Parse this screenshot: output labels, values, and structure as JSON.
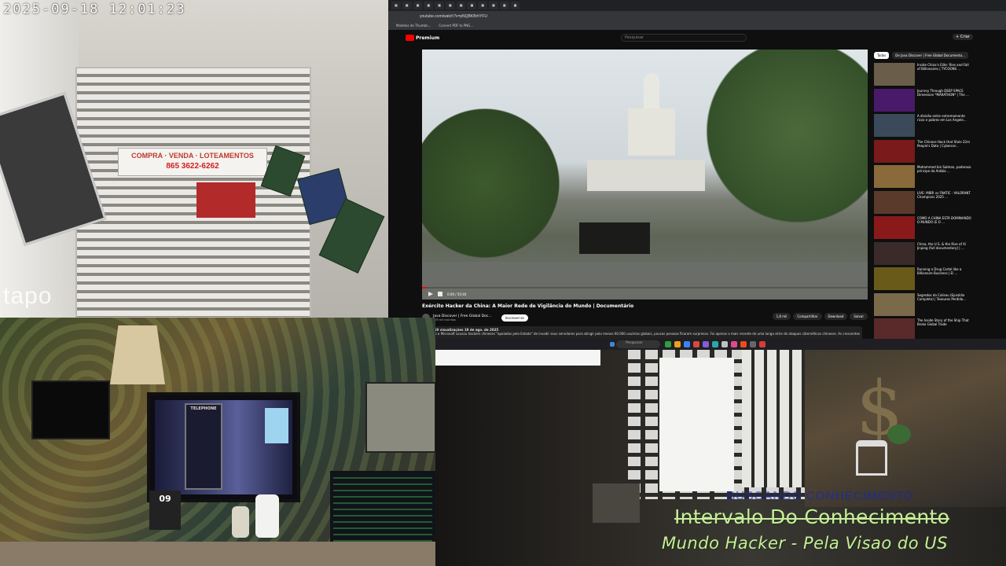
{
  "camera_top_left": {
    "timestamp": "2025-09-18  12:01:23",
    "brand": "tapo",
    "sign_line1": "COMPRA · VENDA · LOTEAMENTOS",
    "sign_phone": "865 3622-6262"
  },
  "youtube": {
    "url": "youtube.com/watch?v=pNQBKBrhYFU",
    "bookmarks": [
      "Modelos de Thumbn...",
      "Convert PDF to PNG..."
    ],
    "logo": "Premium",
    "search_placeholder": "Pesquisar",
    "create_label": "+ Criar",
    "time": "0:00 / 50:40",
    "video_title": "Exército Hacker da China: A Maior Rede de Vigilância do Mundo | Documentário",
    "channel_name": "Java Discover | Free Global Doc...",
    "channel_subs": "809 mil inscritos",
    "subscribe_label": "Inscrever-se",
    "actions": [
      "1,8 mil",
      "Compartilhar",
      "Download",
      "Salvar"
    ],
    "description_meta": "101.619 visualizações  19 de ago. de 2025",
    "description_text": "Quando a Microsoft acusou hackers chineses \"apoiados pelo Estado\" de invadir seus servidores para atingir pelo menos 60.000 usuários globais, poucas pessoas ficaram surpresas. Foi apenas o mais recente de uma longa série de ataques cibernéticos chineses. As crescentes preocupações",
    "chips": [
      "Todos",
      "De Java Discover | Free Global Documenta..."
    ],
    "recommendations": [
      {
        "title": "Inside China's Elite: Rise and Fall of Billionaires | TYCOONS ..."
      },
      {
        "title": "Journey Through DEEP SPACE Dimension *MARATHON* | The ..."
      },
      {
        "title": "A divisão entre extremamente ricos e pobres em Los Angele..."
      },
      {
        "title": "The Chinese Hack that Stole 22m People's Data | Cybercor..."
      },
      {
        "title": "Mohammed bin Salman, poderoso príncipe da Arábia ..."
      },
      {
        "title": "LIVE: MIBR vs FNATIC - VALORANT Champions 2025 ..."
      },
      {
        "title": "COMO A CHINA ESTÁ DOMINANDO O MUNDO (E O ..."
      },
      {
        "title": "China, the U.S. & the Rise of Xi Jinping (full documentary) | ..."
      },
      {
        "title": "Running a Drug Cartel like a Billionaire Business | El ..."
      },
      {
        "title": "Segredos do Coliseu (Episódio Completo) | Tesouros Perdido..."
      },
      {
        "title": "The Inside Story of the Ship That Broke Global Trade"
      }
    ],
    "taskbar_search": "Pesquisar"
  },
  "camera_bottom_left": {
    "tv_label": "TELEPHONE",
    "calendar_day": "09"
  },
  "camera_bottom_right": {
    "caption_dim": "BUSCANDO CONHECIMENTO",
    "caption_main": "Intervalo Do Conhecimento",
    "caption_sub": "Mundo Hacker - Pela Visao do US"
  }
}
